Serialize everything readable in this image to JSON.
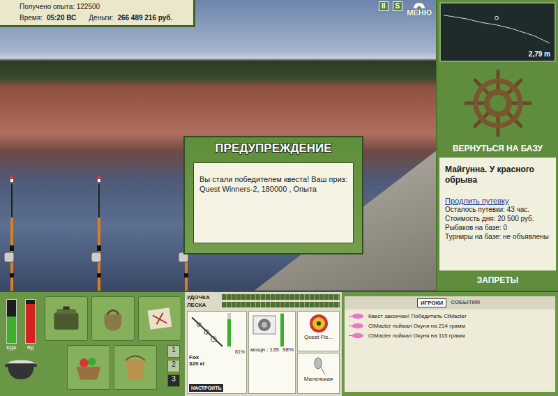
{
  "status": {
    "experience": "Получено опыта: 122500",
    "time_label": "Время:",
    "time": "05:20 ВС",
    "money_label": "Деньги:",
    "money": "266 489 216 руб."
  },
  "toolbar": {
    "pause": "II",
    "sound": "S",
    "menu": "МЕНЮ"
  },
  "scene": {
    "rods": [
      {
        "float": true
      },
      {
        "float": true
      },
      {
        "float": true
      }
    ]
  },
  "dialog": {
    "title": "ПРЕДУПРЕЖДЕНИЕ",
    "message": "Вы стали победителем квеста! Ваш приз: Quest Winners-2, 180000 , Опыта"
  },
  "depth_map": {
    "depth": "2,79 m",
    "profile": [
      0.5,
      0.6,
      0.7,
      0.8,
      0.95,
      1.1,
      1.2,
      1.3,
      1.45,
      1.6,
      1.8,
      2.0,
      2.2,
      2.5,
      2.79
    ],
    "marker_index": 7
  },
  "location": {
    "return": "ВЕРНУТЬСЯ НА БАЗУ",
    "name": "Майгунна. У красного обрыва",
    "extend_link": "Продлить путевку",
    "details": [
      "Осталось путевки: 43 час.",
      "Стоимость дня: 20 500 руб.",
      "Рыбаков на базе: 0",
      "Турниры на базе: не объявлены"
    ],
    "bans": "ЗАПРЕТЫ"
  },
  "meters": [
    {
      "label": "ЕДА",
      "level": 0.6,
      "color": "#3fae2e"
    },
    {
      "label": "ЯД",
      "level": 0.9,
      "color": "#d42222"
    }
  ],
  "slots": [
    {
      "label": "1",
      "selected": false
    },
    {
      "label": "2",
      "selected": false
    },
    {
      "label": "3",
      "selected": true
    }
  ],
  "tackle": {
    "bars": [
      {
        "label": "УДОЧКА",
        "level": 0
      },
      {
        "label": "ЛЕСКА",
        "level": 0
      }
    ],
    "rod": {
      "name": "Fox",
      "strength": "320 кг",
      "wear": "81%",
      "level": 0.81
    },
    "reel": {
      "power": "мощн.: 135",
      "wear": "98%",
      "level": 0.98
    },
    "line": {
      "name": "Quest Fis..."
    },
    "lure": {
      "name": "Маленькая"
    },
    "setup": "НАСТРОИТЬ"
  },
  "chat": {
    "tabs": [
      {
        "label": "ИГРОКИ",
        "selected": true
      },
      {
        "label": "СОБЫТИЯ",
        "selected": false
      }
    ],
    "messages": [
      "Квест закончен! Победитель CtMacter",
      "CtMacter поймал Окуня на 214 грамм",
      "CtMacter поймал Окуня на 115 грамм"
    ]
  }
}
